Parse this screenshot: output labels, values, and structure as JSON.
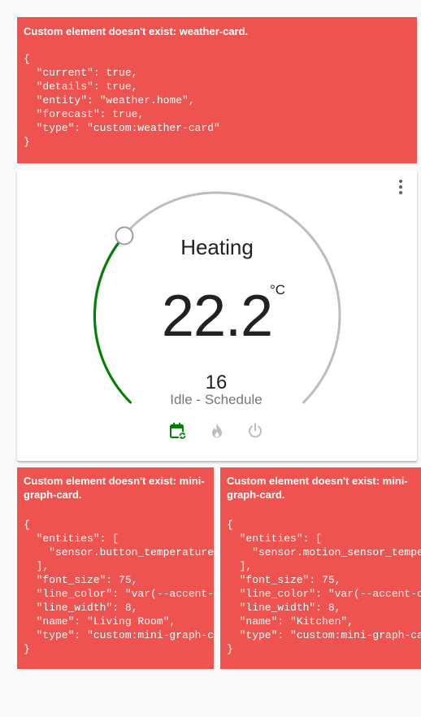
{
  "weather_error": {
    "title": "Custom element doesn't exist: weather-card.",
    "config": "{\n  \"current\": true,\n  \"details\": true,\n  \"entity\": \"weather.home\",\n  \"forecast\": true,\n  \"type\": \"custom:weather-card\"\n}"
  },
  "thermostat": {
    "status": "Heating",
    "current_temperature": "22.2",
    "unit": "°C",
    "target_temperature": "16",
    "mode_text": "Idle - Schedule",
    "active_color": "#008000",
    "track_color": "#bdbdbd",
    "modes": [
      {
        "icon": "calendar-sync-icon",
        "active": true
      },
      {
        "icon": "fire-icon",
        "active": false
      },
      {
        "icon": "power-icon",
        "active": false
      }
    ]
  },
  "mini_graph_errors": [
    {
      "title": "Custom element doesn't exist: mini-graph-card.",
      "config": "{\n  \"entities\": [\n    \"sensor.button_temperature_\n  ],\n  \"font_size\": 75,\n  \"line_color\": \"var(--accent-c\n  \"line_width\": 8,\n  \"name\": \"Living Room\",\n  \"type\": \"custom:mini-graph-ca\n}"
    },
    {
      "title": "Custom element doesn't exist: mini-graph-card.",
      "config": "{\n  \"entities\": [\n    \"sensor.motion_sensor_tempe\n  ],\n  \"font_size\": 75,\n  \"line_color\": \"var(--accent-c\n  \"line_width\": 8,\n  \"name\": \"Kitchen\",\n  \"type\": \"custom:mini-graph-ca\n}"
    }
  ]
}
